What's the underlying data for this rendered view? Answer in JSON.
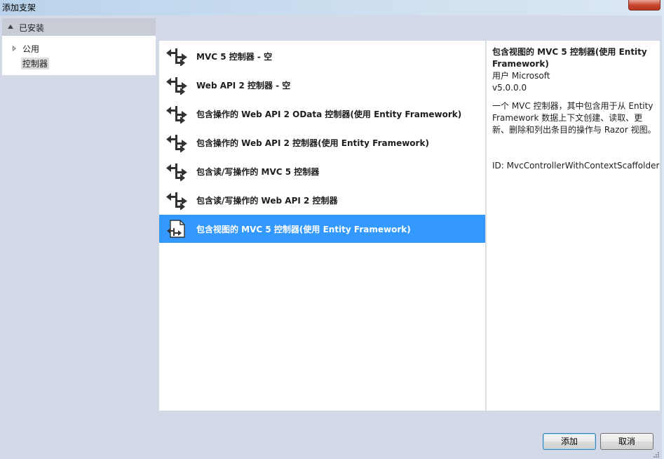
{
  "window": {
    "title": "添加支架"
  },
  "sidebar": {
    "header": "已安装",
    "items": [
      {
        "label": "公用",
        "expandable": true,
        "selected": false
      },
      {
        "label": "控制器",
        "expandable": false,
        "selected": true
      }
    ]
  },
  "templates": [
    {
      "label": "MVC 5 控制器 - 空",
      "icon": "controller-arrows-icon",
      "selected": false
    },
    {
      "label": "Web API 2 控制器 - 空",
      "icon": "controller-arrows-icon",
      "selected": false
    },
    {
      "label": "包含操作的 Web API 2 OData 控制器(使用 Entity Framework)",
      "icon": "controller-arrows-icon",
      "selected": false
    },
    {
      "label": "包含操作的 Web API 2 控制器(使用 Entity Framework)",
      "icon": "controller-arrows-icon",
      "selected": false
    },
    {
      "label": "包含读/写操作的 MVC 5 控制器",
      "icon": "controller-arrows-icon",
      "selected": false
    },
    {
      "label": "包含读/写操作的 Web API 2 控制器",
      "icon": "controller-arrows-icon",
      "selected": false
    },
    {
      "label": "包含视图的 MVC 5 控制器(使用 Entity Framework)",
      "icon": "controller-with-views-icon",
      "selected": true
    }
  ],
  "details": {
    "title": "包含视图的 MVC 5 控制器(使用 Entity Framework)",
    "author": "用户 Microsoft",
    "version": "v5.0.0.0",
    "description": "一个 MVC 控制器，其中包含用于从 Entity Framework 数据上下文创建、读取、更新、删除和列出条目的操作与 Razor 视图。",
    "id": "ID: MvcControllerWithContextScaffolder"
  },
  "buttons": {
    "add": "添加",
    "cancel": "取消"
  },
  "colors": {
    "selection": "#3399ff",
    "client": "#d3d9e7",
    "sidebar_header": "#c7ccd5"
  }
}
